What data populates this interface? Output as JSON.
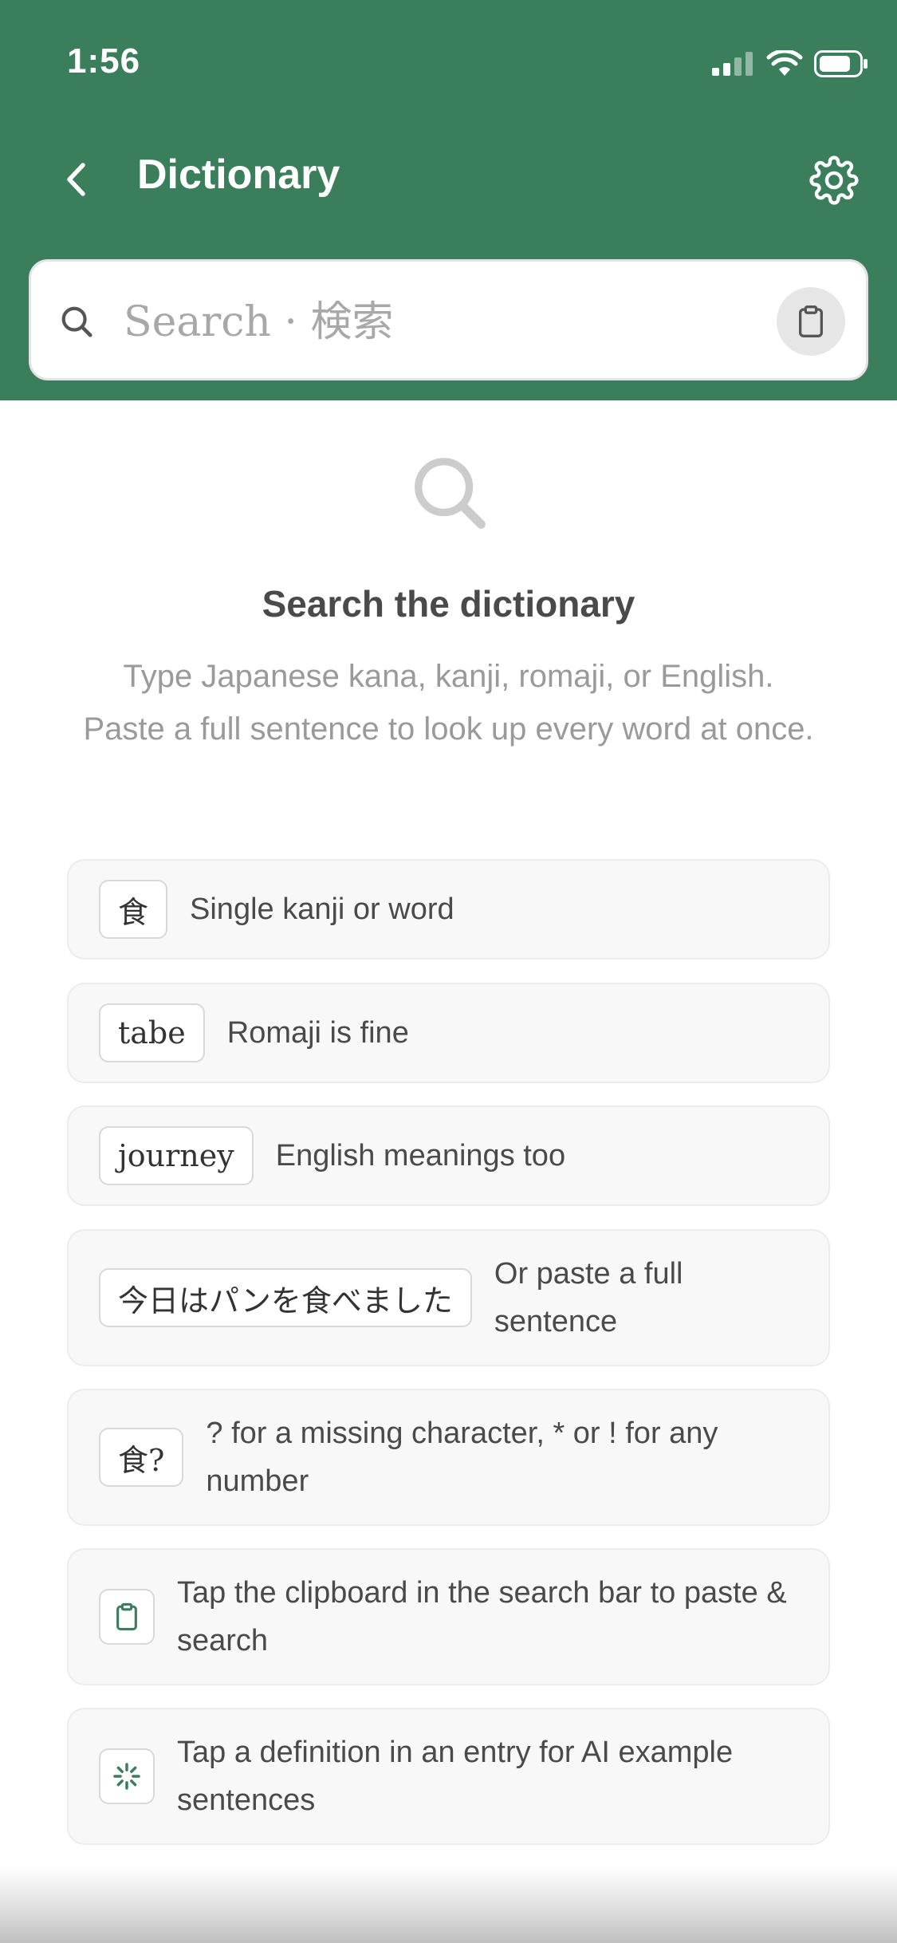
{
  "status_bar": {
    "time": "1:56"
  },
  "header": {
    "title": "Dictionary",
    "back_icon": "chevron-left-icon",
    "settings_icon": "gear-icon",
    "background_color": "#3a7e5c"
  },
  "search": {
    "placeholder": "Search · 検索",
    "value": "",
    "paste_icon": "clipboard-icon"
  },
  "empty_state": {
    "icon": "search-icon",
    "title": "Search the dictionary",
    "subtitle": "Type Japanese kana, kanji, romaji, or English. Paste a full sentence to look up every word at once."
  },
  "tips": [
    {
      "chip": "食",
      "text": "Single kanji or word"
    },
    {
      "chip": "tabe",
      "text": "Romaji is fine"
    },
    {
      "chip": "journey",
      "text": "English meanings too"
    },
    {
      "chip": "今日はパンを食べました",
      "text": "Or paste a full sentence"
    },
    {
      "chip": "食?",
      "text": "? for a missing character, * or ! for any number"
    },
    {
      "icon": "clipboard-icon",
      "text": "Tap the clipboard in the search bar to paste & search"
    },
    {
      "icon": "sparkle-icon",
      "text": "Tap a definition in an entry for AI example sentences"
    }
  ],
  "colors": {
    "accent": "#3a7e5c",
    "card_bg": "#f8f8f8",
    "muted_text": "#9a9a9a"
  }
}
